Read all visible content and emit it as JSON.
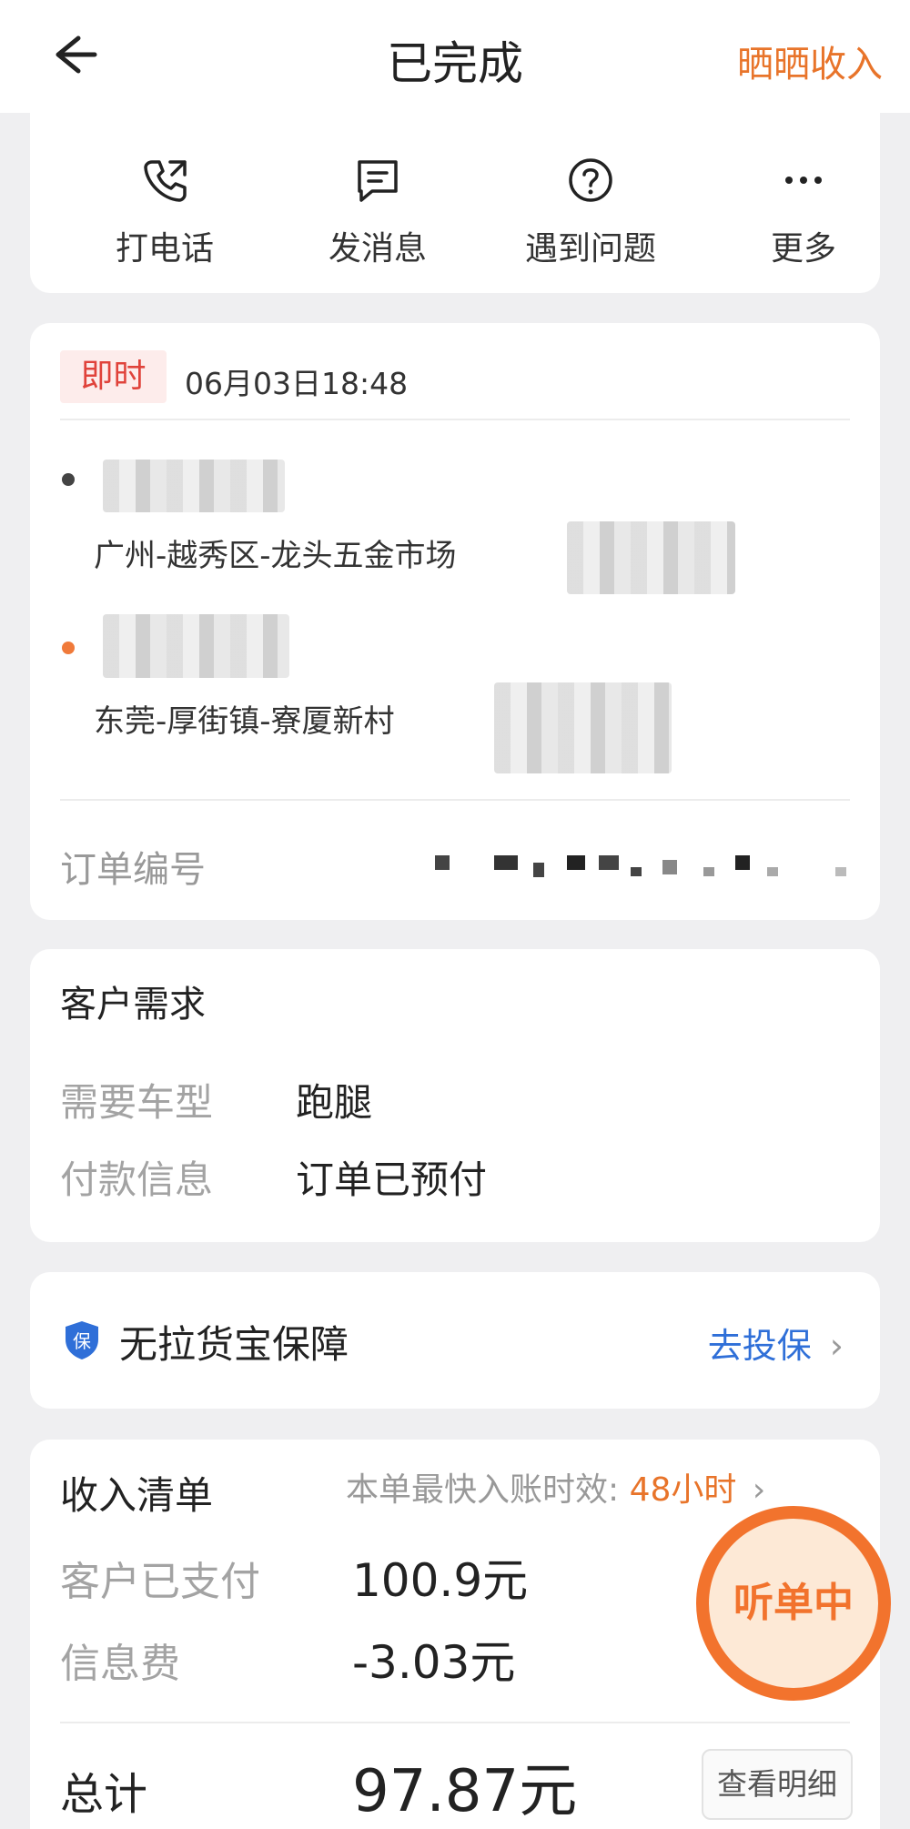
{
  "header": {
    "title": "已完成",
    "action_label": "晒晒收入"
  },
  "quick_actions": [
    {
      "label": "打电话",
      "icon": "phone-icon"
    },
    {
      "label": "发消息",
      "icon": "message-icon"
    },
    {
      "label": "遇到问题",
      "icon": "question-icon"
    },
    {
      "label": "更多",
      "icon": "more-icon"
    }
  ],
  "order": {
    "tag": "即时",
    "time": "06月03日18:48",
    "pickup": {
      "name": "",
      "address": "广州-越秀区-龙头五金市场"
    },
    "dropoff": {
      "name": "",
      "address": "东莞-厚街镇-寮厦新村"
    },
    "number_label": "订单编号"
  },
  "needs": {
    "title": "客户需求",
    "vehicle_key": "需要车型",
    "vehicle_val": "跑腿",
    "payment_key": "付款信息",
    "payment_val": "订单已预付"
  },
  "insurance": {
    "label": "无拉货宝保障",
    "link": "去投保",
    "icon": "shield-icon"
  },
  "income": {
    "title": "收入清单",
    "meta_label": "本单最快入账时效:",
    "meta_value": "48小时",
    "paid_key": "客户已支付",
    "paid_val": "100.9元",
    "fee_key": "信息费",
    "fee_val": "-3.03元",
    "total_key": "总计",
    "total_val": "97.87元",
    "detail_btn": "查看明细"
  },
  "float_button": "听单中",
  "colors": {
    "accent": "#e8742a",
    "link": "#2f6fd8",
    "tag_red": "#e0433b"
  }
}
